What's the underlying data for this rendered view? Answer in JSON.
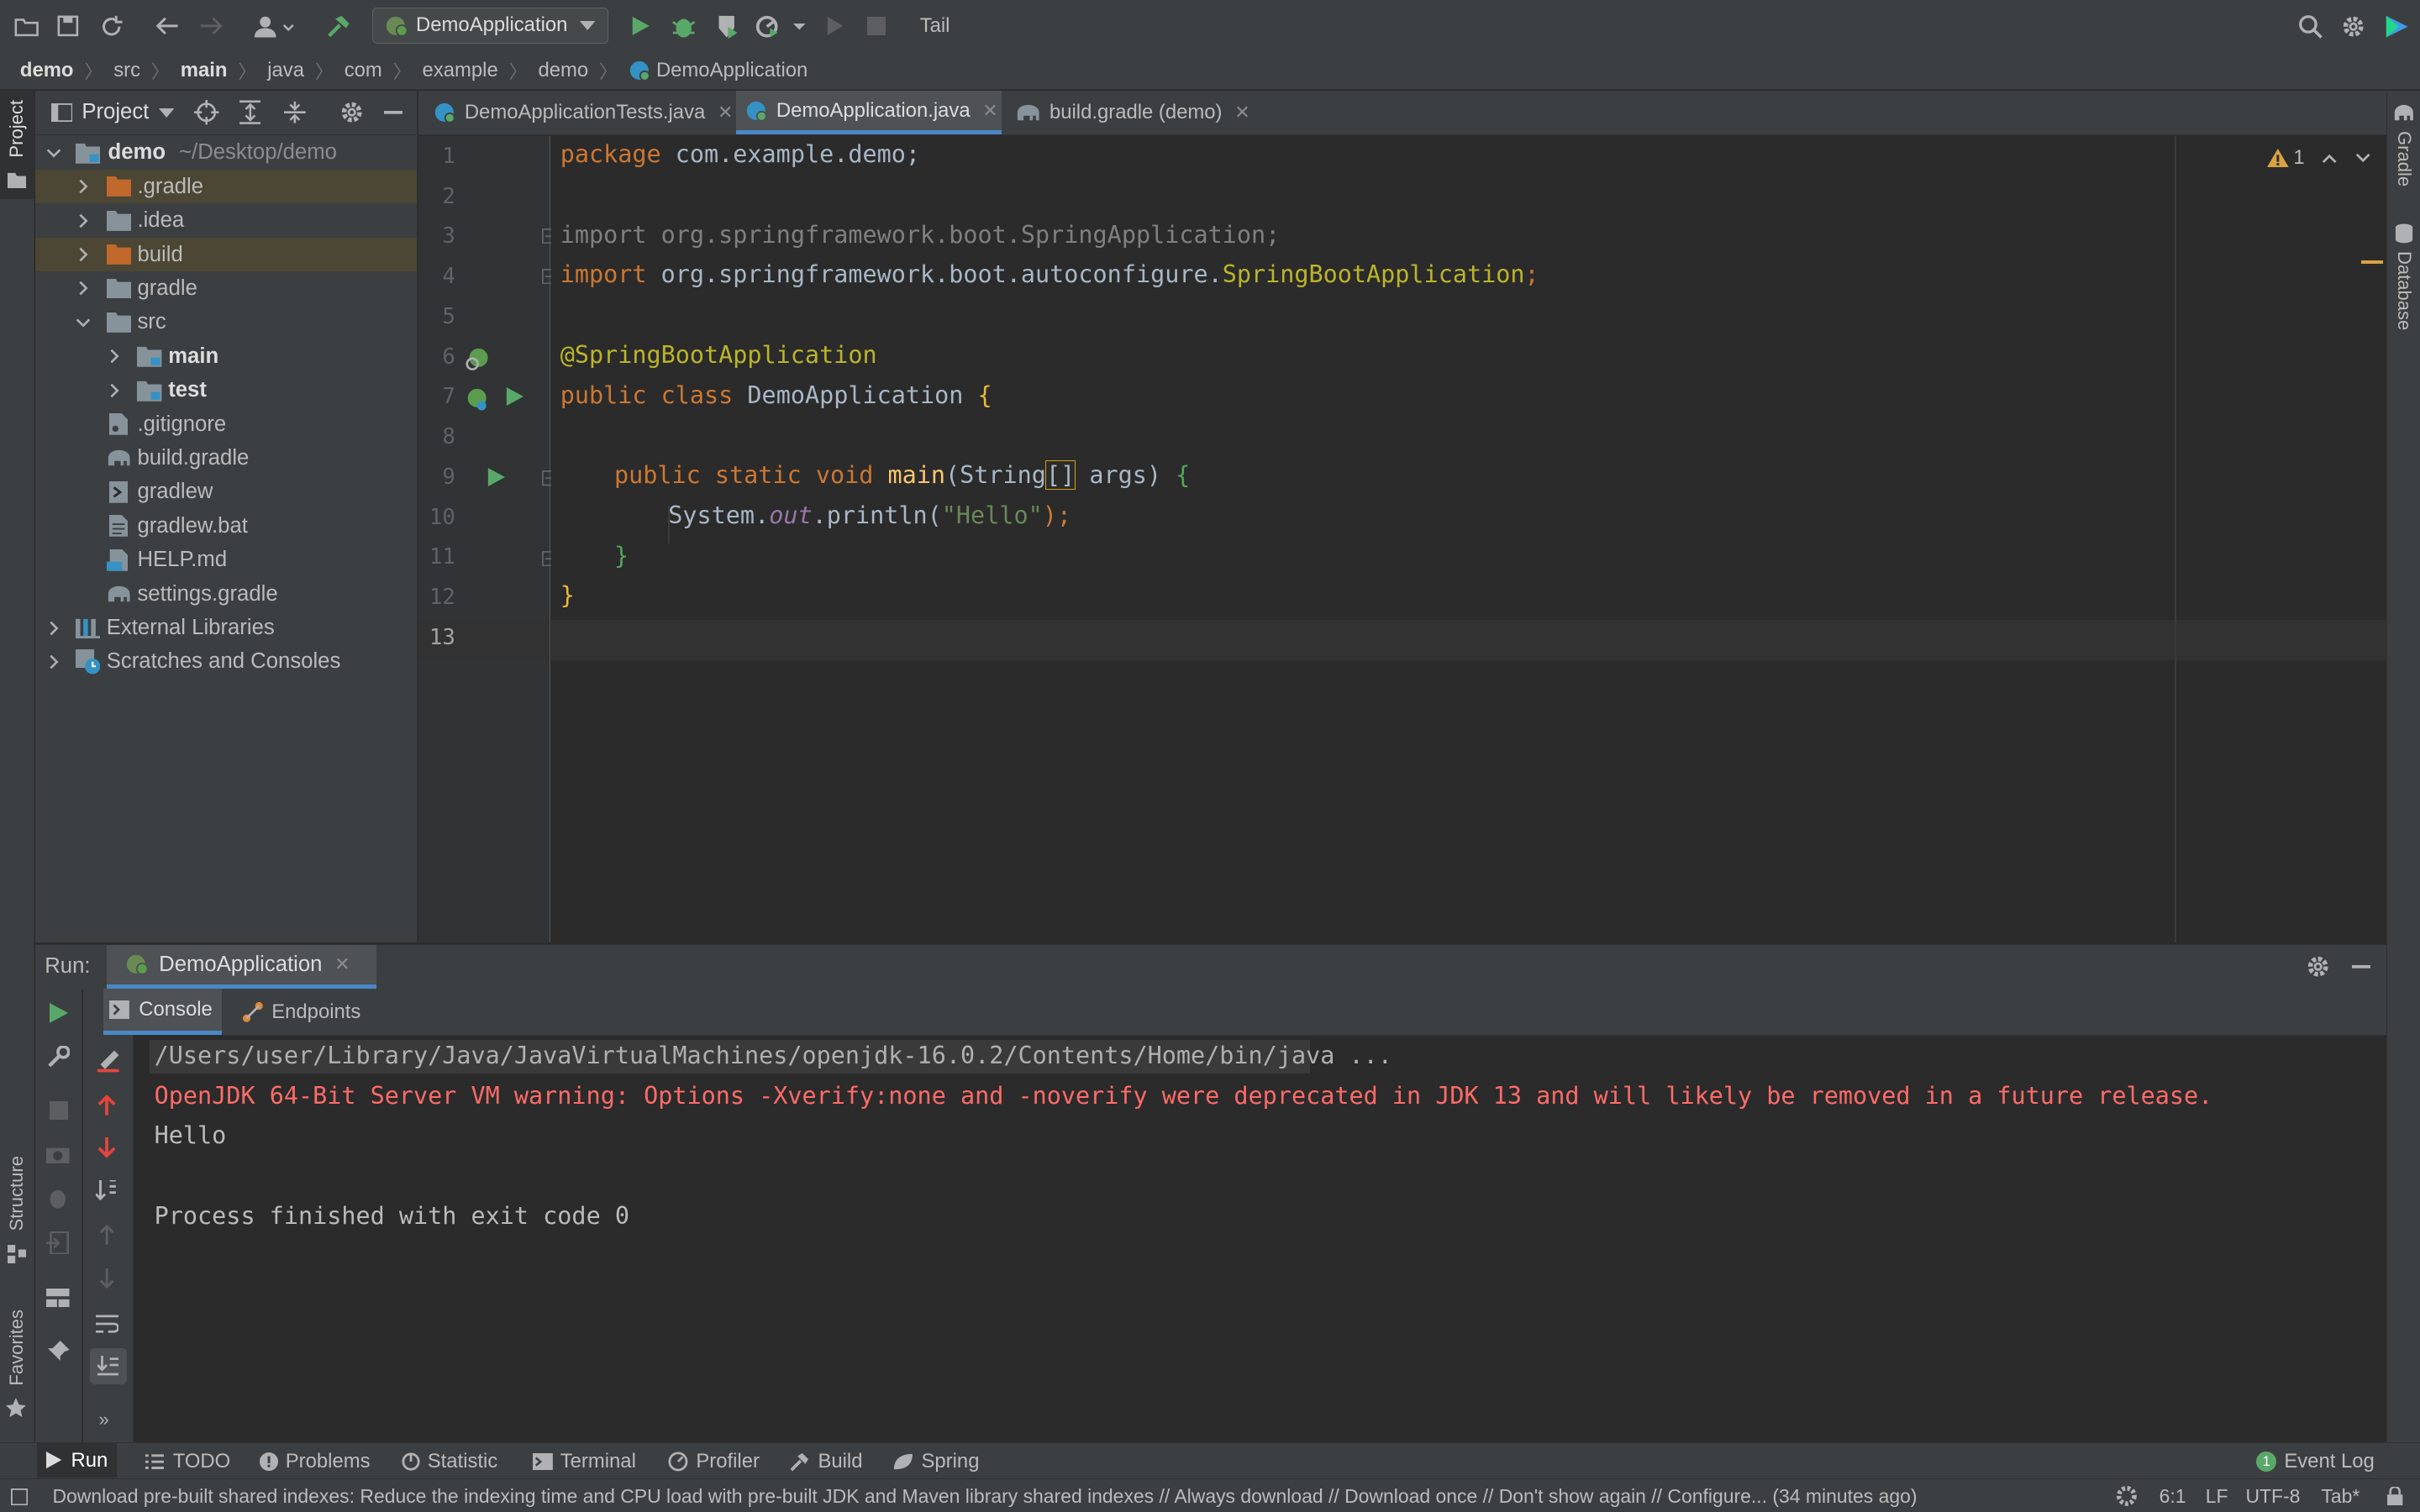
{
  "toolbar": {
    "run_config": "DemoApplication",
    "tail_label": "Tail"
  },
  "breadcrumb": [
    "demo",
    "src",
    "main",
    "java",
    "com",
    "example",
    "demo",
    "DemoApplication"
  ],
  "left_stripe": {
    "project": "Project",
    "structure": "Structure",
    "favorites": "Favorites"
  },
  "right_stripe": {
    "gradle": "Gradle",
    "database": "Database"
  },
  "project_panel": {
    "title": "Project",
    "tree": [
      {
        "label": "demo",
        "path": "~/Desktop/demo",
        "bold": true
      },
      {
        "label": ".gradle"
      },
      {
        "label": ".idea"
      },
      {
        "label": "build"
      },
      {
        "label": "gradle"
      },
      {
        "label": "src"
      },
      {
        "label": "main",
        "bold": true
      },
      {
        "label": "test",
        "bold": true
      },
      {
        "label": ".gitignore"
      },
      {
        "label": "build.gradle"
      },
      {
        "label": "gradlew"
      },
      {
        "label": "gradlew.bat"
      },
      {
        "label": "HELP.md"
      },
      {
        "label": "settings.gradle"
      },
      {
        "label": "External Libraries"
      },
      {
        "label": "Scratches and Consoles"
      }
    ]
  },
  "editor_tabs": [
    {
      "label": "DemoApplicationTests.java",
      "active": false
    },
    {
      "label": "DemoApplication.java",
      "active": true
    },
    {
      "label": "build.gradle (demo)",
      "active": false
    }
  ],
  "editor": {
    "line_numbers": [
      "1",
      "2",
      "3",
      "4",
      "5",
      "6",
      "7",
      "8",
      "9",
      "10",
      "11",
      "12",
      "13"
    ],
    "warning_count": "1",
    "code": {
      "l1_kw": "package",
      "l1_rest": " com.example.demo;",
      "l3_kw": "import",
      "l3_rest": " org.springframework.boot.SpringApplication;",
      "l4_kw": "import",
      "l4_pkg": " org.springframework.boot.autoconfigure.",
      "l4_cls": "SpringBootApplication",
      "l4_end": ";",
      "l6": "@SpringBootApplication",
      "l7_kw": "public class",
      "l7_name": " DemoApplication ",
      "l7_brace": "{",
      "l9_kw": "public static void",
      "l9_fn": " main",
      "l9_args": "(String",
      "l9_arr": "[]",
      "l9_rest": " args) ",
      "l9_brace": "{",
      "l10_a": "System.",
      "l10_out": "out",
      "l10_b": ".println(",
      "l10_str": "\"Hello\"",
      "l10_c": ");",
      "l11": "}",
      "l12": "}"
    }
  },
  "run_panel": {
    "label": "Run:",
    "tab": "DemoApplication",
    "subtabs": {
      "console": "Console",
      "endpoints": "Endpoints"
    },
    "console_lines": [
      "/Users/user/Library/Java/JavaVirtualMachines/openjdk-16.0.2/Contents/Home/bin/java ...",
      "OpenJDK 64-Bit Server VM warning: Options -Xverify:none and -noverify were deprecated in JDK 13 and will likely be removed in a future release.",
      "Hello",
      "",
      "Process finished with exit code 0"
    ]
  },
  "bottom_tabs": {
    "run": "Run",
    "todo": "TODO",
    "problems": "Problems",
    "statistic": "Statistic",
    "terminal": "Terminal",
    "profiler": "Profiler",
    "build": "Build",
    "spring": "Spring",
    "event_log": "Event Log",
    "event_count": "1"
  },
  "status_bar": {
    "message": "Download pre-built shared indexes: Reduce the indexing time and CPU load with pre-built JDK and Maven library shared indexes // Always download // Download once // Don't show again // Configure... (34 minutes ago)",
    "position": "6:1",
    "line_sep": "LF",
    "encoding": "UTF-8",
    "indent": "Tab*"
  },
  "colors": {
    "accent": "#4a88c7",
    "run_green": "#59a869",
    "error_red": "#ff6b68",
    "selection": "#4b4734"
  }
}
